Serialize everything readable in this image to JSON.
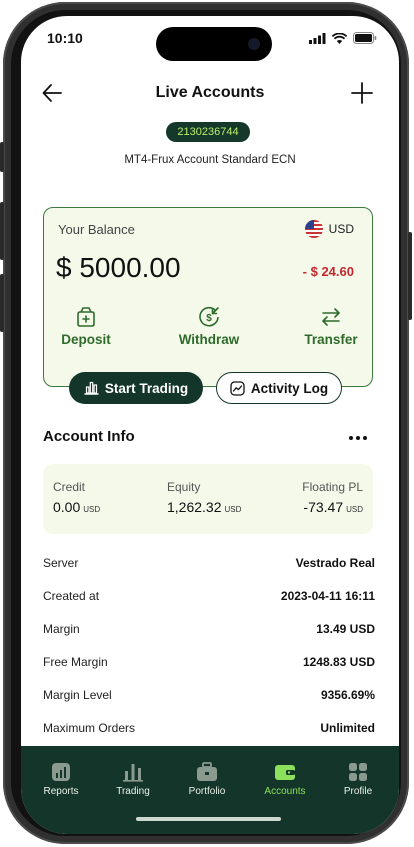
{
  "status": {
    "time": "10:10"
  },
  "header": {
    "title": "Live Accounts"
  },
  "account": {
    "number": "2130236744",
    "name": "MT4-Frux Account Standard ECN"
  },
  "balance": {
    "label": "Your Balance",
    "currency": "USD",
    "amount": "$ 5000.00",
    "change": "- $ 24.60",
    "actions": [
      {
        "label": "Deposit",
        "icon": "deposit-icon"
      },
      {
        "label": "Withdraw",
        "icon": "withdraw-icon"
      },
      {
        "label": "Transfer",
        "icon": "transfer-icon"
      }
    ]
  },
  "buttons": {
    "start_trading": "Start Trading",
    "activity_log": "Activity Log"
  },
  "account_info": {
    "title": "Account Info",
    "stats": [
      {
        "label": "Credit",
        "value": "0.00",
        "unit": "USD"
      },
      {
        "label": "Equity",
        "value": "1,262.32",
        "unit": "USD"
      },
      {
        "label": "Floating PL",
        "value": "-73.47",
        "unit": "USD"
      }
    ],
    "rows": [
      {
        "label": "Server",
        "value": "Vestrado Real"
      },
      {
        "label": "Created at",
        "value": "2023-04-11 16:11"
      },
      {
        "label": "Margin",
        "value": "13.49 USD"
      },
      {
        "label": "Free Margin",
        "value": "1248.83 USD"
      },
      {
        "label": "Margin Level",
        "value": "9356.69%"
      },
      {
        "label": "Maximum Orders",
        "value": "Unlimited"
      }
    ]
  },
  "tabs": [
    {
      "label": "Reports",
      "icon": "reports-icon"
    },
    {
      "label": "Trading",
      "icon": "trading-icon"
    },
    {
      "label": "Portfolio",
      "icon": "portfolio-icon"
    },
    {
      "label": "Accounts",
      "icon": "accounts-icon",
      "active": true
    },
    {
      "label": "Profile",
      "icon": "profile-icon"
    }
  ],
  "colors": {
    "brand_dark": "#14362a",
    "accent_green": "#2e6b2b",
    "active_tab": "#8be05c",
    "negative": "#c4262e"
  }
}
